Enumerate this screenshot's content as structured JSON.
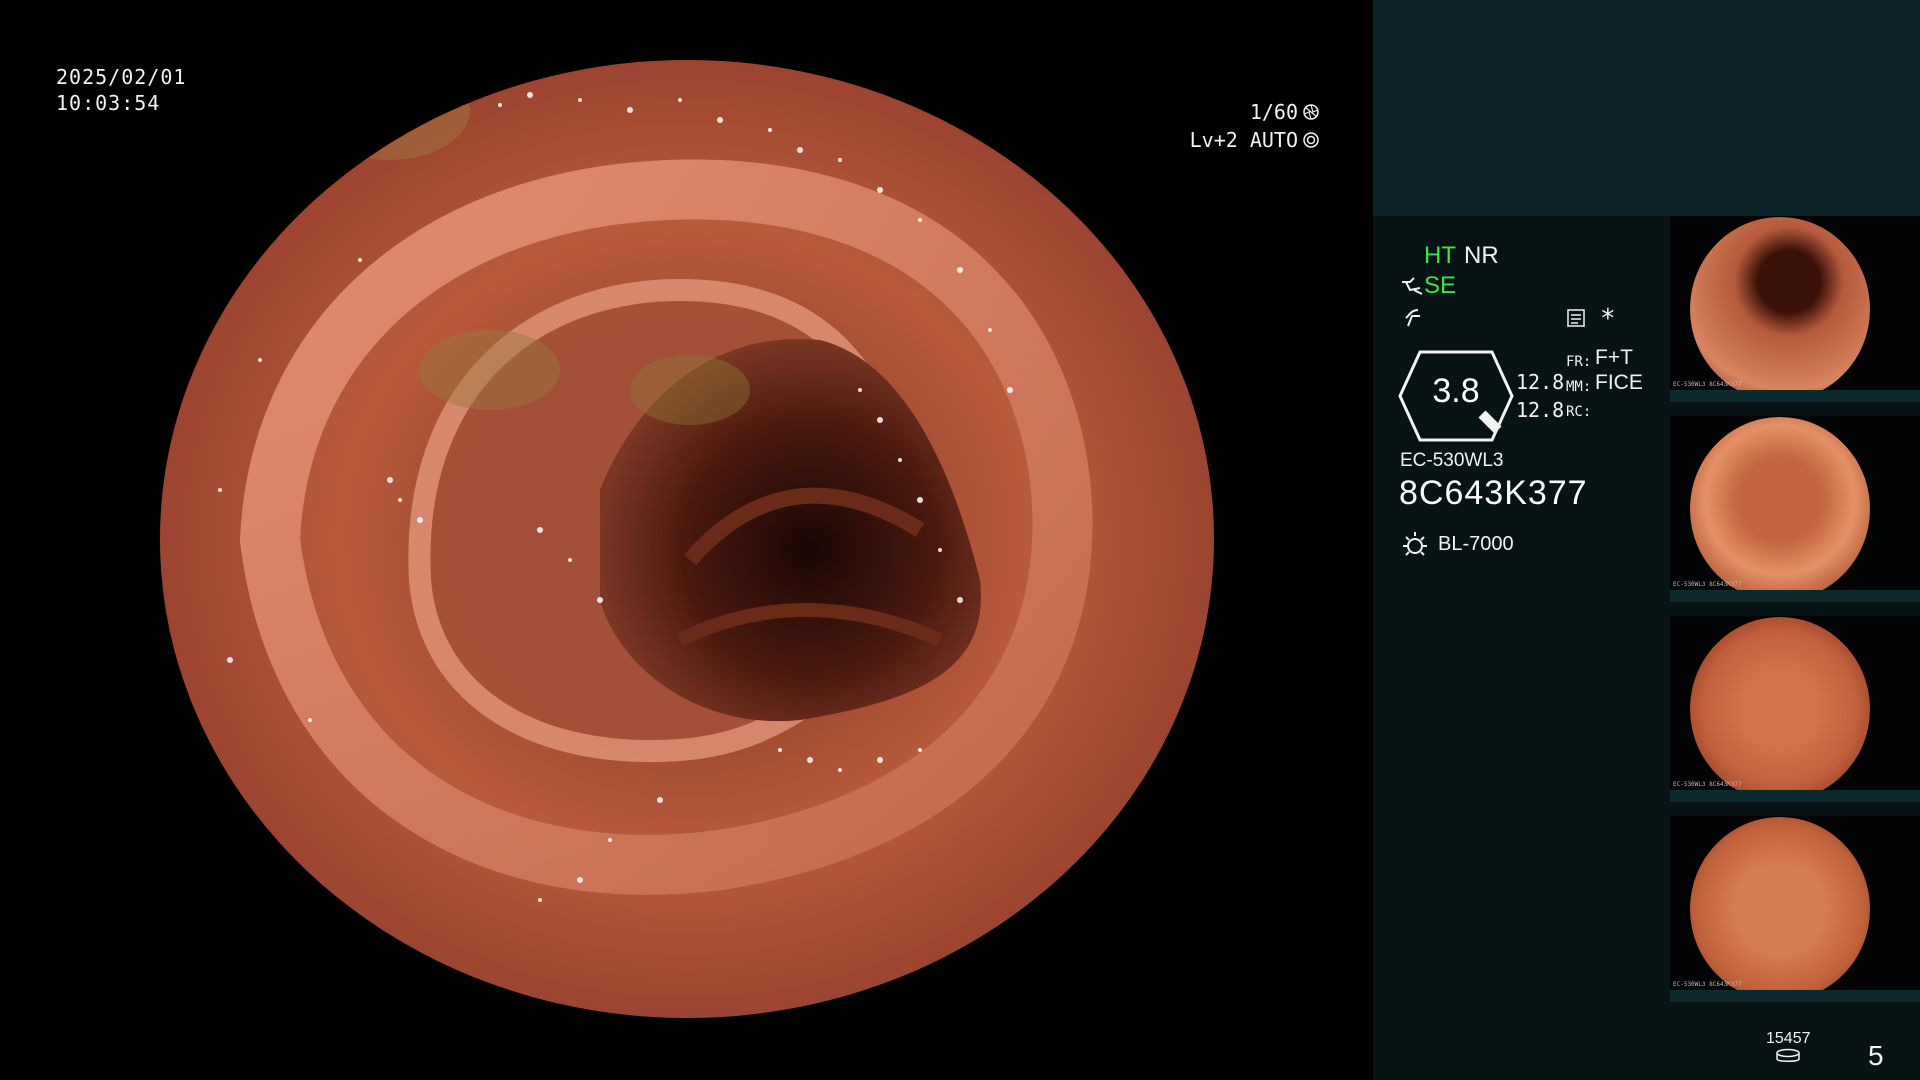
{
  "overlay": {
    "date": "2025/02/01",
    "time": "10:03:54",
    "shutter": "1/60",
    "level": "Lv+2 AUTO"
  },
  "panel": {
    "ht": "HT",
    "nr": "NR",
    "se": "SE",
    "asterisk": "*",
    "gauge_value": "3.8",
    "gauge_sub1": "12.8",
    "gauge_sub2": "12.8",
    "param_labels": [
      "FR:",
      "MM:",
      "RC:"
    ],
    "param_values": [
      "F+T",
      "FICE",
      ""
    ],
    "model": "EC-530WL3",
    "serial": "8C643K377",
    "light_source": "BL-7000",
    "thumbnails": [
      {
        "bottom_label": "EC-530WL3 8C643K377"
      },
      {
        "bottom_label": "EC-530WL3 8C643K377"
      },
      {
        "bottom_label": "EC-530WL3 8C643K377"
      },
      {
        "bottom_label": "EC-530WL3 8C643K377"
      }
    ],
    "image_count": "15457",
    "page_number": "5"
  },
  "colors": {
    "active_green": "#3ee43e",
    "panel_bg": "#071315",
    "panel_top_bg": "#0b2226"
  }
}
